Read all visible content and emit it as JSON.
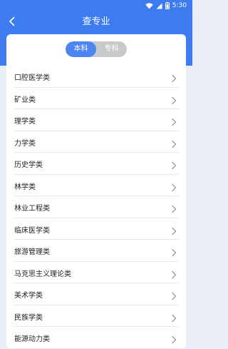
{
  "status_bar": {
    "time": "5:30"
  },
  "header": {
    "title": "查专业"
  },
  "segmented": {
    "options": [
      "本科",
      "专科"
    ],
    "selected": "本科"
  },
  "majors": [
    "口腔医学类",
    "矿业类",
    "理学类",
    "力学类",
    "历史学类",
    "林学类",
    "林业工程类",
    "临床医学类",
    "旅游管理类",
    "马克思主义理论类",
    "美术学类",
    "民族学类",
    "能源动力类"
  ],
  "colors": {
    "header_blue": "#3f7bf0",
    "active_segment": "#4d86f3",
    "inactive_segment": "#c9c9c9",
    "page_bg": "#e9edf5"
  },
  "icons": {
    "back": "chevron-left-icon",
    "row_arrow": "chevron-right-icon",
    "wifi": "wifi-icon",
    "signal": "signal-icon",
    "battery": "battery-icon"
  }
}
